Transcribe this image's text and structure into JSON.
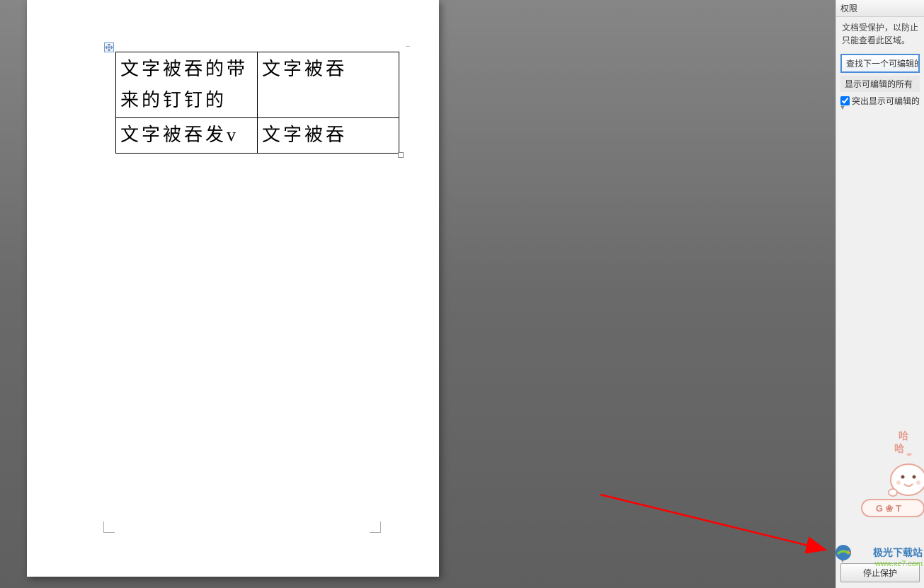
{
  "sidebar": {
    "header": "权限",
    "description_line1": "文档受保护，以防止",
    "description_line2": "只能查看此区域。",
    "find_next_button": "查找下一个可编辑的",
    "show_all_link": "显示可编辑的所有",
    "highlight_checkbox_label": "突出显示可编辑的",
    "highlight_checked": true,
    "stop_protection_button": "停止保护"
  },
  "table": {
    "cells": {
      "a1": "文字被吞的带来的钉钉的",
      "b1": "文字被吞",
      "a2": "文字被吞发v",
      "b2": "文字被吞"
    }
  },
  "watermark": {
    "name": "极光下载站",
    "url": "www.xz7.com"
  },
  "cartoon": {
    "haha1": "哈",
    "haha2": "哈",
    "button_text": "G ❀ T"
  }
}
